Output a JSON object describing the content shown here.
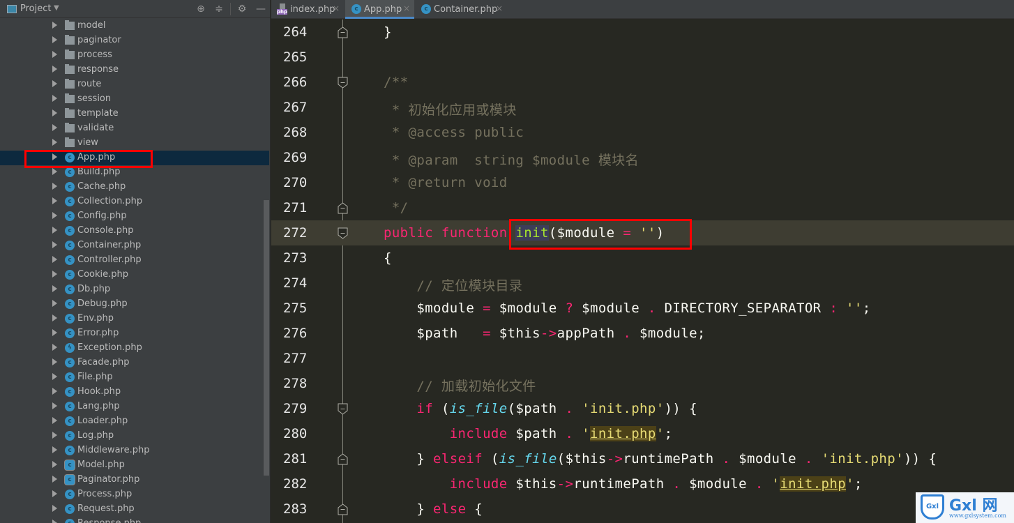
{
  "project_panel": {
    "title": "Project",
    "dropdown_icon": "triangle-down",
    "buttons": [
      {
        "name": "locate-icon",
        "glyph": "⊕"
      },
      {
        "name": "collapse-all-icon",
        "glyph": "≑"
      },
      {
        "name": "gear-icon",
        "glyph": "⚙"
      },
      {
        "name": "minimize-icon",
        "glyph": "—"
      }
    ],
    "tree": [
      {
        "label": "model",
        "type": "folder"
      },
      {
        "label": "paginator",
        "type": "folder"
      },
      {
        "label": "process",
        "type": "folder"
      },
      {
        "label": "response",
        "type": "folder"
      },
      {
        "label": "route",
        "type": "folder"
      },
      {
        "label": "session",
        "type": "folder"
      },
      {
        "label": "template",
        "type": "folder"
      },
      {
        "label": "validate",
        "type": "folder"
      },
      {
        "label": "view",
        "type": "folder"
      },
      {
        "label": "App.php",
        "type": "class",
        "selected": true
      },
      {
        "label": "Build.php",
        "type": "class"
      },
      {
        "label": "Cache.php",
        "type": "class"
      },
      {
        "label": "Collection.php",
        "type": "class"
      },
      {
        "label": "Config.php",
        "type": "class"
      },
      {
        "label": "Console.php",
        "type": "class"
      },
      {
        "label": "Container.php",
        "type": "class"
      },
      {
        "label": "Controller.php",
        "type": "class"
      },
      {
        "label": "Cookie.php",
        "type": "class"
      },
      {
        "label": "Db.php",
        "type": "class"
      },
      {
        "label": "Debug.php",
        "type": "class"
      },
      {
        "label": "Env.php",
        "type": "class"
      },
      {
        "label": "Error.php",
        "type": "class"
      },
      {
        "label": "Exception.php",
        "type": "exception"
      },
      {
        "label": "Facade.php",
        "type": "class"
      },
      {
        "label": "File.php",
        "type": "class"
      },
      {
        "label": "Hook.php",
        "type": "class"
      },
      {
        "label": "Lang.php",
        "type": "class"
      },
      {
        "label": "Loader.php",
        "type": "class"
      },
      {
        "label": "Log.php",
        "type": "class"
      },
      {
        "label": "Middleware.php",
        "type": "class"
      },
      {
        "label": "Model.php",
        "type": "abstract"
      },
      {
        "label": "Paginator.php",
        "type": "abstract"
      },
      {
        "label": "Process.php",
        "type": "class"
      },
      {
        "label": "Request.php",
        "type": "class"
      },
      {
        "label": "Response.php",
        "type": "class"
      }
    ]
  },
  "tabs": [
    {
      "label": "index.php",
      "icon": "php-file",
      "active": false,
      "close": "×"
    },
    {
      "label": "App.php",
      "icon": "class",
      "active": true,
      "close": "×"
    },
    {
      "label": "Container.php",
      "icon": "class",
      "active": false,
      "close": "×"
    }
  ],
  "editor": {
    "current_line": 272,
    "lines": [
      {
        "n": "264",
        "fold": "end",
        "tokens": [
          [
            "",
            "}"
          ]
        ]
      },
      {
        "n": "265",
        "tokens": []
      },
      {
        "n": "266",
        "fold": "start",
        "tokens": [
          [
            "cm",
            "/**"
          ]
        ]
      },
      {
        "n": "267",
        "tokens": [
          [
            "cm",
            " * 初始化应用或模块"
          ]
        ]
      },
      {
        "n": "268",
        "tokens": [
          [
            "cm",
            " * @access public"
          ]
        ]
      },
      {
        "n": "269",
        "tokens": [
          [
            "cm",
            " * @param  string $module 模块名"
          ]
        ]
      },
      {
        "n": "270",
        "tokens": [
          [
            "cm",
            " * @return void"
          ]
        ]
      },
      {
        "n": "271",
        "fold": "end",
        "tokens": [
          [
            "cm",
            " */"
          ]
        ]
      },
      {
        "n": "272",
        "fold": "start",
        "tokens": [
          [
            "kw",
            "public function "
          ],
          [
            "caret",
            ""
          ],
          [
            "fnsel",
            "init"
          ],
          [
            "",
            "($module "
          ],
          [
            "op",
            "="
          ],
          [
            "",
            " "
          ],
          [
            "str",
            "''"
          ],
          [
            "",
            ")"
          ]
        ]
      },
      {
        "n": "273",
        "tokens": [
          [
            "",
            "{"
          ]
        ]
      },
      {
        "n": "274",
        "tokens": [
          [
            "cm",
            "    // 定位模块目录"
          ]
        ]
      },
      {
        "n": "275",
        "tokens": [
          [
            "",
            "    $module "
          ],
          [
            "op",
            "="
          ],
          [
            "",
            " $module "
          ],
          [
            "op",
            "?"
          ],
          [
            "",
            " $module "
          ],
          [
            "op",
            "."
          ],
          [
            "",
            " DIRECTORY_SEPARATOR "
          ],
          [
            "op",
            ":"
          ],
          [
            "",
            " "
          ],
          [
            "str",
            "''"
          ],
          [
            "",
            ";"
          ]
        ]
      },
      {
        "n": "276",
        "tokens": [
          [
            "",
            "    $path   "
          ],
          [
            "op",
            "="
          ],
          [
            "",
            " $this"
          ],
          [
            "op",
            "->"
          ],
          [
            "",
            "appPath "
          ],
          [
            "op",
            "."
          ],
          [
            "",
            " $module;"
          ]
        ]
      },
      {
        "n": "277",
        "tokens": []
      },
      {
        "n": "278",
        "tokens": [
          [
            "cm",
            "    // 加载初始化文件"
          ]
        ]
      },
      {
        "n": "279",
        "fold": "start",
        "tokens": [
          [
            "kw",
            "    if"
          ],
          [
            "",
            " ("
          ],
          [
            "ital",
            "is_file"
          ],
          [
            "",
            "($path "
          ],
          [
            "op",
            "."
          ],
          [
            "",
            " "
          ],
          [
            "str",
            "'init.php'"
          ],
          [
            "",
            ")) {"
          ]
        ]
      },
      {
        "n": "280",
        "tokens": [
          [
            "kw",
            "        include"
          ],
          [
            "",
            " $path "
          ],
          [
            "op",
            "."
          ],
          [
            "",
            " "
          ],
          [
            "str",
            "'"
          ],
          [
            "strhl",
            "init.php"
          ],
          [
            "str",
            "'"
          ],
          [
            "",
            ";"
          ]
        ]
      },
      {
        "n": "281",
        "fold": "mid",
        "tokens": [
          [
            "",
            "    } "
          ],
          [
            "kw",
            "elseif"
          ],
          [
            "",
            " ("
          ],
          [
            "ital",
            "is_file"
          ],
          [
            "",
            "($this"
          ],
          [
            "op",
            "->"
          ],
          [
            "",
            "runtimePath "
          ],
          [
            "op",
            "."
          ],
          [
            "",
            " $module "
          ],
          [
            "op",
            "."
          ],
          [
            "",
            " "
          ],
          [
            "str",
            "'init.php'"
          ],
          [
            "",
            ")) {"
          ]
        ]
      },
      {
        "n": "282",
        "tokens": [
          [
            "kw",
            "        include"
          ],
          [
            "",
            " $this"
          ],
          [
            "op",
            "->"
          ],
          [
            "",
            "runtimePath "
          ],
          [
            "op",
            "."
          ],
          [
            "",
            " $module "
          ],
          [
            "op",
            "."
          ],
          [
            "",
            " "
          ],
          [
            "str",
            "'"
          ],
          [
            "strhl",
            "init.php"
          ],
          [
            "str",
            "'"
          ],
          [
            "",
            ";"
          ]
        ]
      },
      {
        "n": "283",
        "fold": "mid",
        "tokens": [
          [
            "",
            "    } "
          ],
          [
            "kw",
            "else"
          ],
          [
            "",
            " {"
          ]
        ]
      }
    ]
  },
  "watermark": {
    "shield_text": "Gxl",
    "brand": "Gxl 网",
    "url": "www.gxlsystem.com"
  }
}
